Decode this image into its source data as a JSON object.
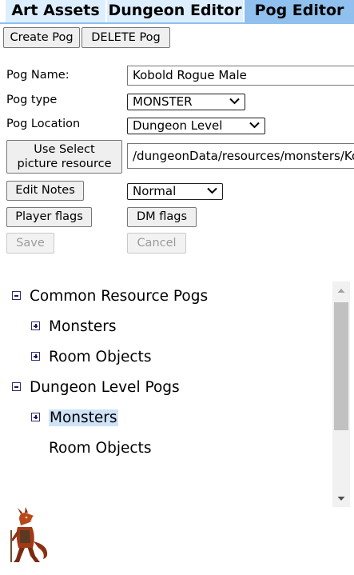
{
  "tabs": [
    {
      "label": "Art Assets",
      "active": false
    },
    {
      "label": "Dungeon Editor",
      "active": false
    },
    {
      "label": "Pog Editor",
      "active": true
    }
  ],
  "toolbar": {
    "create_label": "Create Pog",
    "delete_label": "DELETE Pog"
  },
  "form": {
    "name_label": "Pog Name:",
    "name_value": "Kobold Rogue Male",
    "type_label": "Pog type",
    "type_value": "MONSTER",
    "location_label": "Pog Location",
    "location_value": "Dungeon Level",
    "picture_button": "Use Select picture resource",
    "picture_button_line1": "Use Select",
    "picture_button_line2": "picture resource",
    "picture_path": "/dungeonData/resources/monsters/Kob",
    "edit_notes_label": "Edit Notes",
    "size_value": "Normal",
    "player_flags_label": "Player flags",
    "dm_flags_label": "DM flags",
    "save_label": "Save",
    "cancel_label": "Cancel"
  },
  "tree": {
    "groups": [
      {
        "label": "Common Resource Pogs",
        "expanded": true,
        "children": [
          {
            "label": "Monsters",
            "expandable": true,
            "selected": false
          },
          {
            "label": "Room Objects",
            "expandable": true,
            "selected": false
          }
        ]
      },
      {
        "label": "Dungeon Level Pogs",
        "expanded": true,
        "children": [
          {
            "label": "Monsters",
            "expandable": true,
            "selected": true
          },
          {
            "label": "Room Objects",
            "expandable": false,
            "selected": false
          }
        ]
      }
    ]
  },
  "preview": {
    "icon": "kobold-rogue-icon"
  },
  "colors": {
    "tab_bg": "#ddeeff",
    "tab_active": "#8fc0ee",
    "selected_bg": "#cfe3f7"
  }
}
